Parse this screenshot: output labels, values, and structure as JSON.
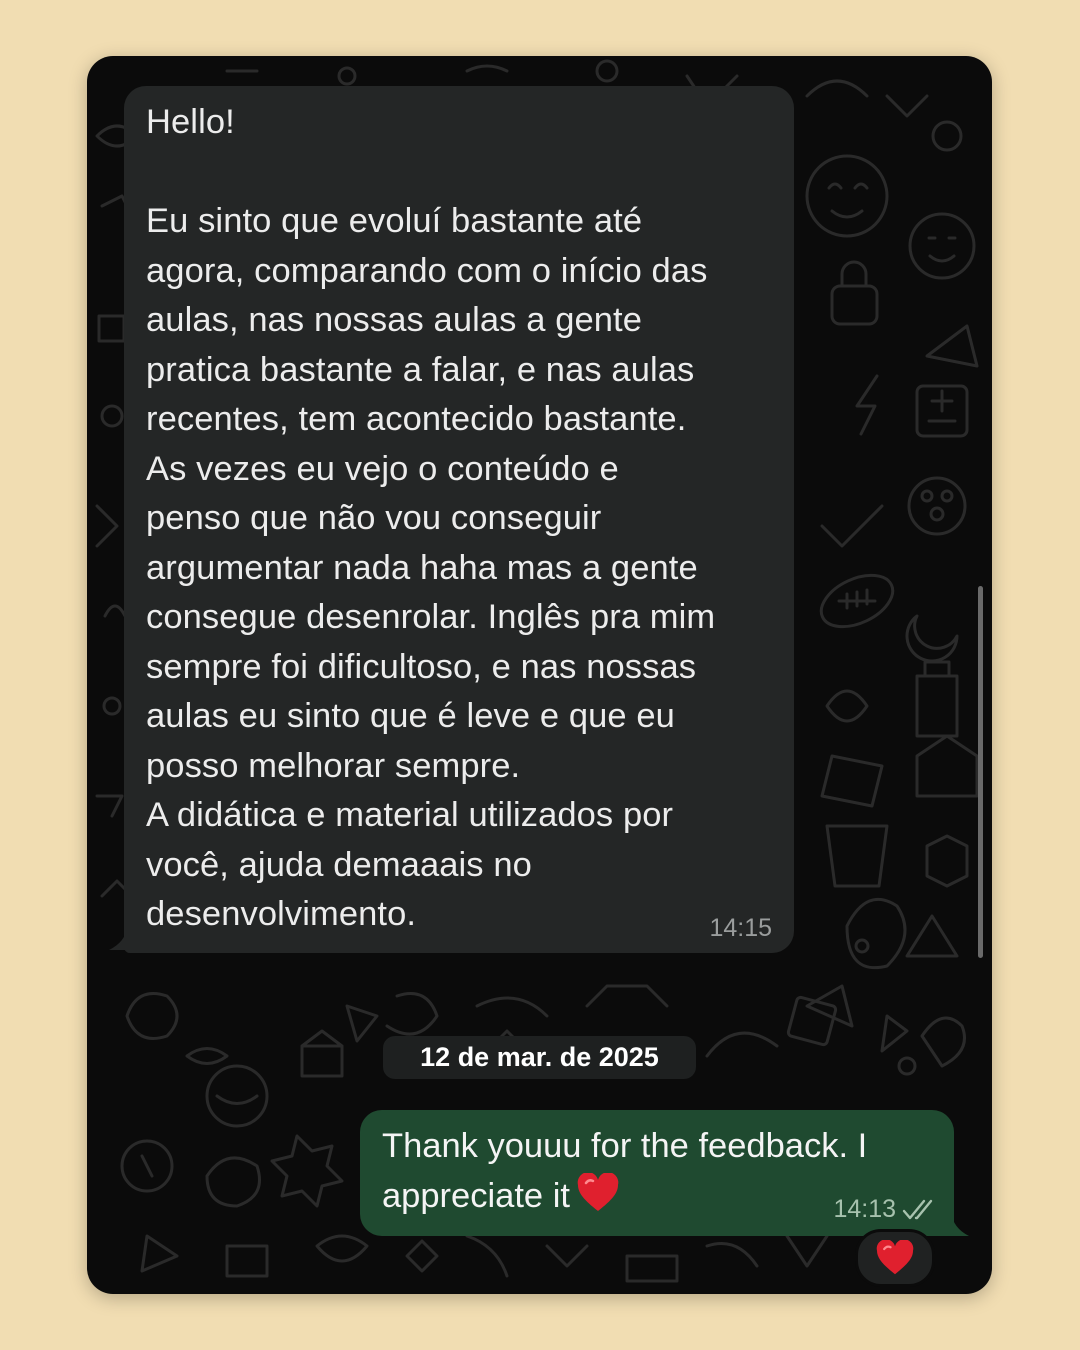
{
  "messages": {
    "incoming": {
      "text": "Hello!\n\nEu sinto que evoluí bastante até\nagora, comparando com o início das\naulas, nas nossas aulas a gente\npratica bastante a falar, e nas aulas\nrecentes, tem acontecido bastante.\nAs vezes eu vejo o conteúdo e\npenso que não vou conseguir\nargumentar nada haha mas a gente\nconsegue desenrolar. Inglês pra mim\nsempre foi dificultoso, e nas nossas\naulas eu sinto que é leve e que eu\nposso melhorar sempre.\nA didática e material utilizados por\nvocê, ajuda demaaais no\ndesenvolvimento.",
      "time": "14:15"
    },
    "date_separator": "12 de mar. de 2025",
    "outgoing": {
      "text": "Thank youuu for the feedback. I\nappreciate it",
      "time": "14:13",
      "status_icon": "double-check-icon",
      "reaction": "heart-icon"
    }
  },
  "colors": {
    "page_background": "#f1ddb2",
    "chat_background": "#0b0b0b",
    "incoming_bubble": "#242626",
    "outgoing_bubble": "#1f4a30",
    "heart": "#e0202e"
  }
}
